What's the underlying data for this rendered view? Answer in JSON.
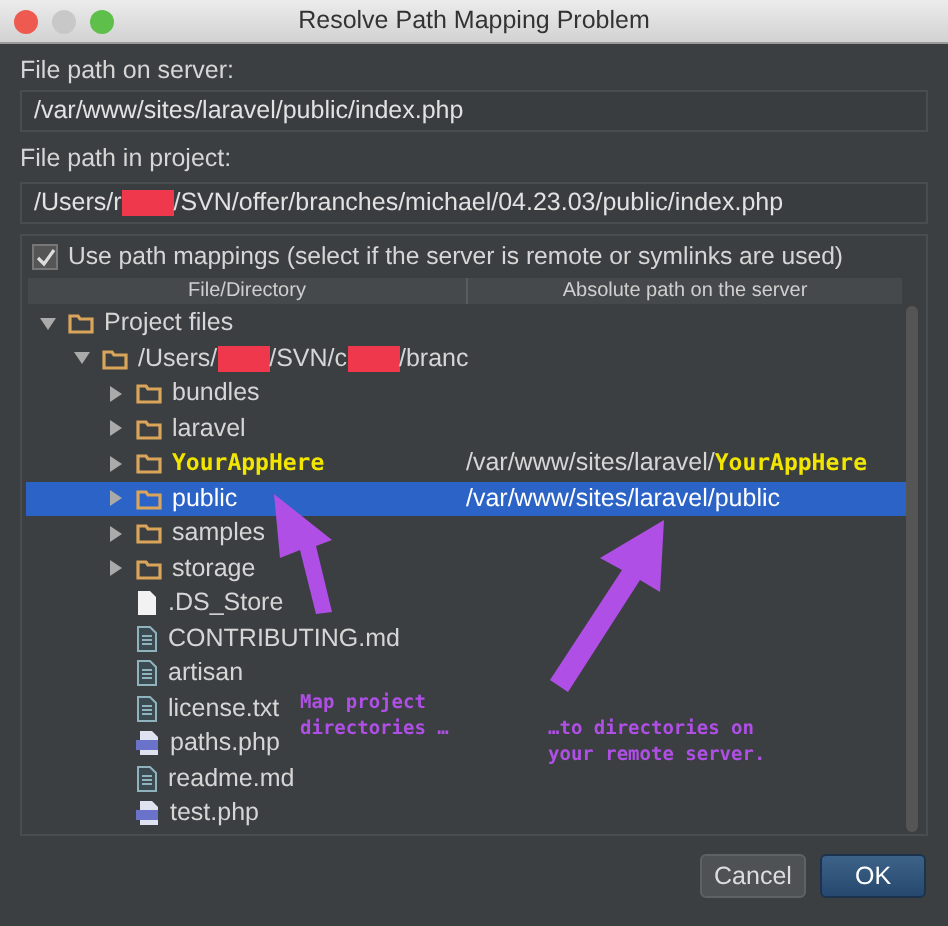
{
  "window": {
    "title": "Resolve Path Mapping Problem"
  },
  "server_path": {
    "label": "File path on server:",
    "value": "/var/www/sites/laravel/public/index.php"
  },
  "project_path": {
    "label": "File path in project:",
    "segments": [
      {
        "kind": "text",
        "text": "/Users/r"
      },
      {
        "kind": "redaction"
      },
      {
        "kind": "text",
        "text": "/SVN/offer/branches/michael/04.23.03/public/index.php"
      }
    ]
  },
  "use_mappings": {
    "label": "Use path mappings (select if the server is remote or symlinks are used)",
    "checked": true
  },
  "table": {
    "columns": [
      "File/Directory",
      "Absolute path on the server"
    ],
    "tree": [
      {
        "kind": "folder",
        "segments": [
          {
            "kind": "text",
            "text": "Project files"
          }
        ],
        "expanded": true,
        "children": [
          {
            "kind": "folder",
            "segments": [
              {
                "kind": "text",
                "text": "/Users/"
              },
              {
                "kind": "redaction"
              },
              {
                "kind": "text",
                "text": "/SVN/c"
              },
              {
                "kind": "redaction"
              },
              {
                "kind": "text",
                "text": "/branc"
              }
            ],
            "expanded": true,
            "children": [
              {
                "kind": "folder",
                "segments": [
                  {
                    "kind": "text",
                    "text": "bundles"
                  }
                ],
                "expanded": false,
                "selected": false
              },
              {
                "kind": "folder",
                "segments": [
                  {
                    "kind": "text",
                    "text": "laravel"
                  }
                ],
                "expanded": false,
                "selected": false
              },
              {
                "kind": "folder",
                "segments": [
                  {
                    "kind": "text",
                    "text": "YourAppHere"
                  }
                ],
                "expanded": false,
                "selected": false,
                "highlight": true,
                "mapping": "/var/www/sites/laravel/",
                "mapping_highlight": "YourAppHere"
              },
              {
                "kind": "folder",
                "segments": [
                  {
                    "kind": "text",
                    "text": "public"
                  }
                ],
                "expanded": false,
                "selected": true,
                "mapping": "/var/www/sites/laravel/public"
              },
              {
                "kind": "folder",
                "segments": [
                  {
                    "kind": "text",
                    "text": "samples"
                  }
                ],
                "expanded": false,
                "selected": false
              },
              {
                "kind": "folder",
                "segments": [
                  {
                    "kind": "text",
                    "text": "storage"
                  }
                ],
                "expanded": false,
                "selected": false
              },
              {
                "kind": "blank",
                "segments": [
                  {
                    "kind": "text",
                    "text": ".DS_Store"
                  }
                ],
                "selected": false
              },
              {
                "kind": "text-file",
                "segments": [
                  {
                    "kind": "text",
                    "text": "CONTRIBUTING.md"
                  }
                ],
                "selected": false
              },
              {
                "kind": "text-file",
                "segments": [
                  {
                    "kind": "text",
                    "text": "artisan"
                  }
                ],
                "selected": false
              },
              {
                "kind": "text-file",
                "segments": [
                  {
                    "kind": "text",
                    "text": "license.txt"
                  }
                ],
                "selected": false
              },
              {
                "kind": "php",
                "segments": [
                  {
                    "kind": "text",
                    "text": "paths.php"
                  }
                ],
                "selected": false
              },
              {
                "kind": "text-file",
                "segments": [
                  {
                    "kind": "text",
                    "text": "readme.md"
                  }
                ],
                "selected": false
              },
              {
                "kind": "php",
                "segments": [
                  {
                    "kind": "text",
                    "text": "test.php"
                  }
                ],
                "selected": false
              }
            ]
          }
        ]
      }
    ]
  },
  "annotations": [
    "Map project directories …",
    "…to directories on your remote server."
  ],
  "buttons": [
    {
      "label": "Cancel",
      "kind": "secondary"
    },
    {
      "label": "OK",
      "kind": "primary"
    }
  ]
}
